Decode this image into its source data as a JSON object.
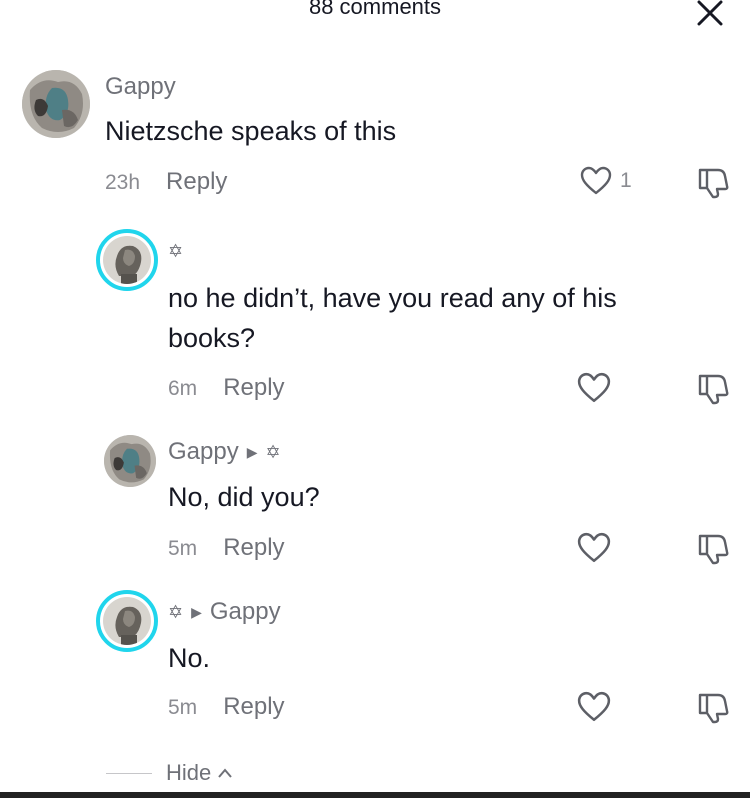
{
  "header": {
    "title": "88 comments"
  },
  "icons": {
    "close": "close-icon",
    "like": "heart-outline-icon",
    "dislike": "thumbs-down-icon",
    "star": "star-of-david-icon",
    "caret": "right-caret-icon",
    "chevron_up": "chevron-up-icon"
  },
  "colors": {
    "ring": "#20d5ec",
    "text": "#161823",
    "muted": "#8a8b91"
  },
  "comments": [
    {
      "username": "Gappy",
      "text": "Nietzsche speaks of this",
      "time": "23h",
      "reply": "Reply",
      "likes": "1"
    },
    {
      "username": "✡",
      "text": "no he didn’t, have you read any of his books?",
      "time": "6m",
      "reply": "Reply"
    },
    {
      "username": "Gappy",
      "reply_to": "✡",
      "text": "No, did you?",
      "time": "5m",
      "reply": "Reply"
    },
    {
      "username": "✡",
      "reply_to": "Gappy",
      "text": "No.",
      "time": "5m",
      "reply": "Reply"
    }
  ],
  "footer": {
    "hide_label": "Hide"
  }
}
